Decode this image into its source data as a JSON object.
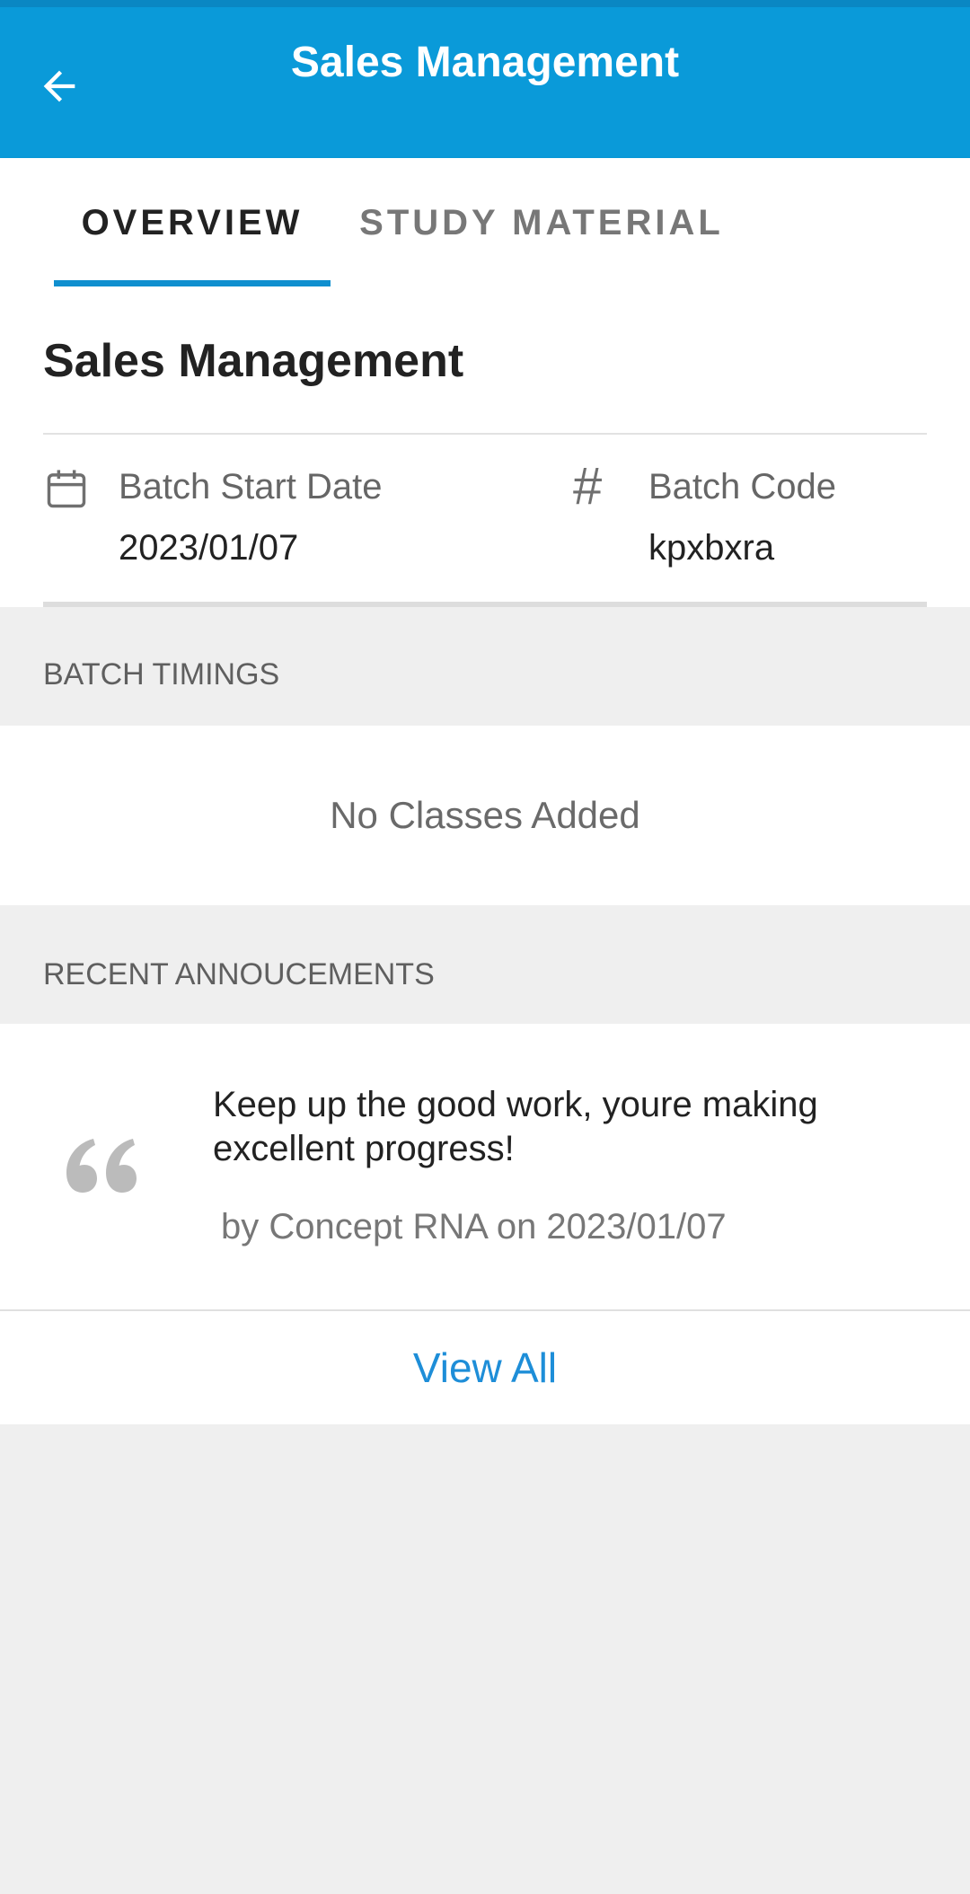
{
  "colors": {
    "appbar": "#0a9ad9",
    "accent": "#0f8fcf",
    "link": "#1e8ed8",
    "background": "#efefef"
  },
  "appbar": {
    "title": "Sales Management",
    "back_icon": "arrow-left-icon"
  },
  "tabs": [
    {
      "label": "OVERVIEW",
      "selected": true
    },
    {
      "label": "STUDY MATERIAL",
      "selected": false
    }
  ],
  "overview": {
    "title": "Sales Management",
    "batch_start": {
      "icon": "calendar-icon",
      "label": "Batch Start Date",
      "value": "2023/01/07"
    },
    "batch_code": {
      "icon": "hash-icon",
      "label": "Batch Code",
      "value": "kpxbxra"
    }
  },
  "batch_timings": {
    "header": "BATCH TIMINGS",
    "empty_text": "No Classes Added"
  },
  "announcements": {
    "header": "RECENT ANNOUCEMENTS",
    "items": [
      {
        "icon": "quote-icon",
        "text": "Keep up the good work, youre making excellent progress!",
        "meta": "by Concept RNA on 2023/01/07"
      }
    ],
    "view_all_label": "View All"
  }
}
